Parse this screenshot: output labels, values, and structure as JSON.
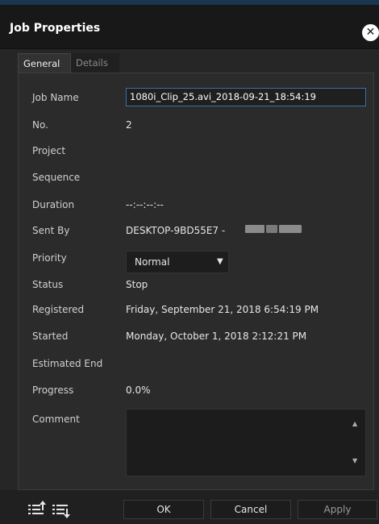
{
  "window": {
    "title": "Job Properties"
  },
  "tabs": [
    {
      "label": "General"
    },
    {
      "label": "Details"
    }
  ],
  "fields": {
    "job_name": {
      "label": "Job Name",
      "value": "1080i_Clip_25.avi_2018-09-21_18:54:19"
    },
    "no": {
      "label": "No.",
      "value": "2"
    },
    "project": {
      "label": "Project",
      "value": ""
    },
    "sequence": {
      "label": "Sequence",
      "value": ""
    },
    "duration": {
      "label": "Duration",
      "value": "--:--:--:--"
    },
    "sent_by": {
      "label": "Sent By",
      "value": "DESKTOP-9BD55E7 - "
    },
    "priority": {
      "label": "Priority",
      "value": "Normal"
    },
    "status": {
      "label": "Status",
      "value": "Stop"
    },
    "registered": {
      "label": "Registered",
      "value": "Friday, September 21, 2018 6:54:19 PM"
    },
    "started": {
      "label": "Started",
      "value": "Monday, October 1, 2018 2:12:21 PM"
    },
    "estimated_end": {
      "label": "Estimated End",
      "value": ""
    },
    "progress": {
      "label": "Progress",
      "value": "0.0%"
    },
    "comment": {
      "label": "Comment",
      "value": ""
    }
  },
  "buttons": {
    "ok": "OK",
    "cancel": "Cancel",
    "apply": "Apply"
  },
  "icons": {
    "close": "close-icon",
    "move_up": "list-move-up-icon",
    "move_down": "list-move-down-icon"
  },
  "colors": {
    "accent": "#3b6ea8",
    "background": "#262626",
    "panel": "#2b2b2b"
  }
}
